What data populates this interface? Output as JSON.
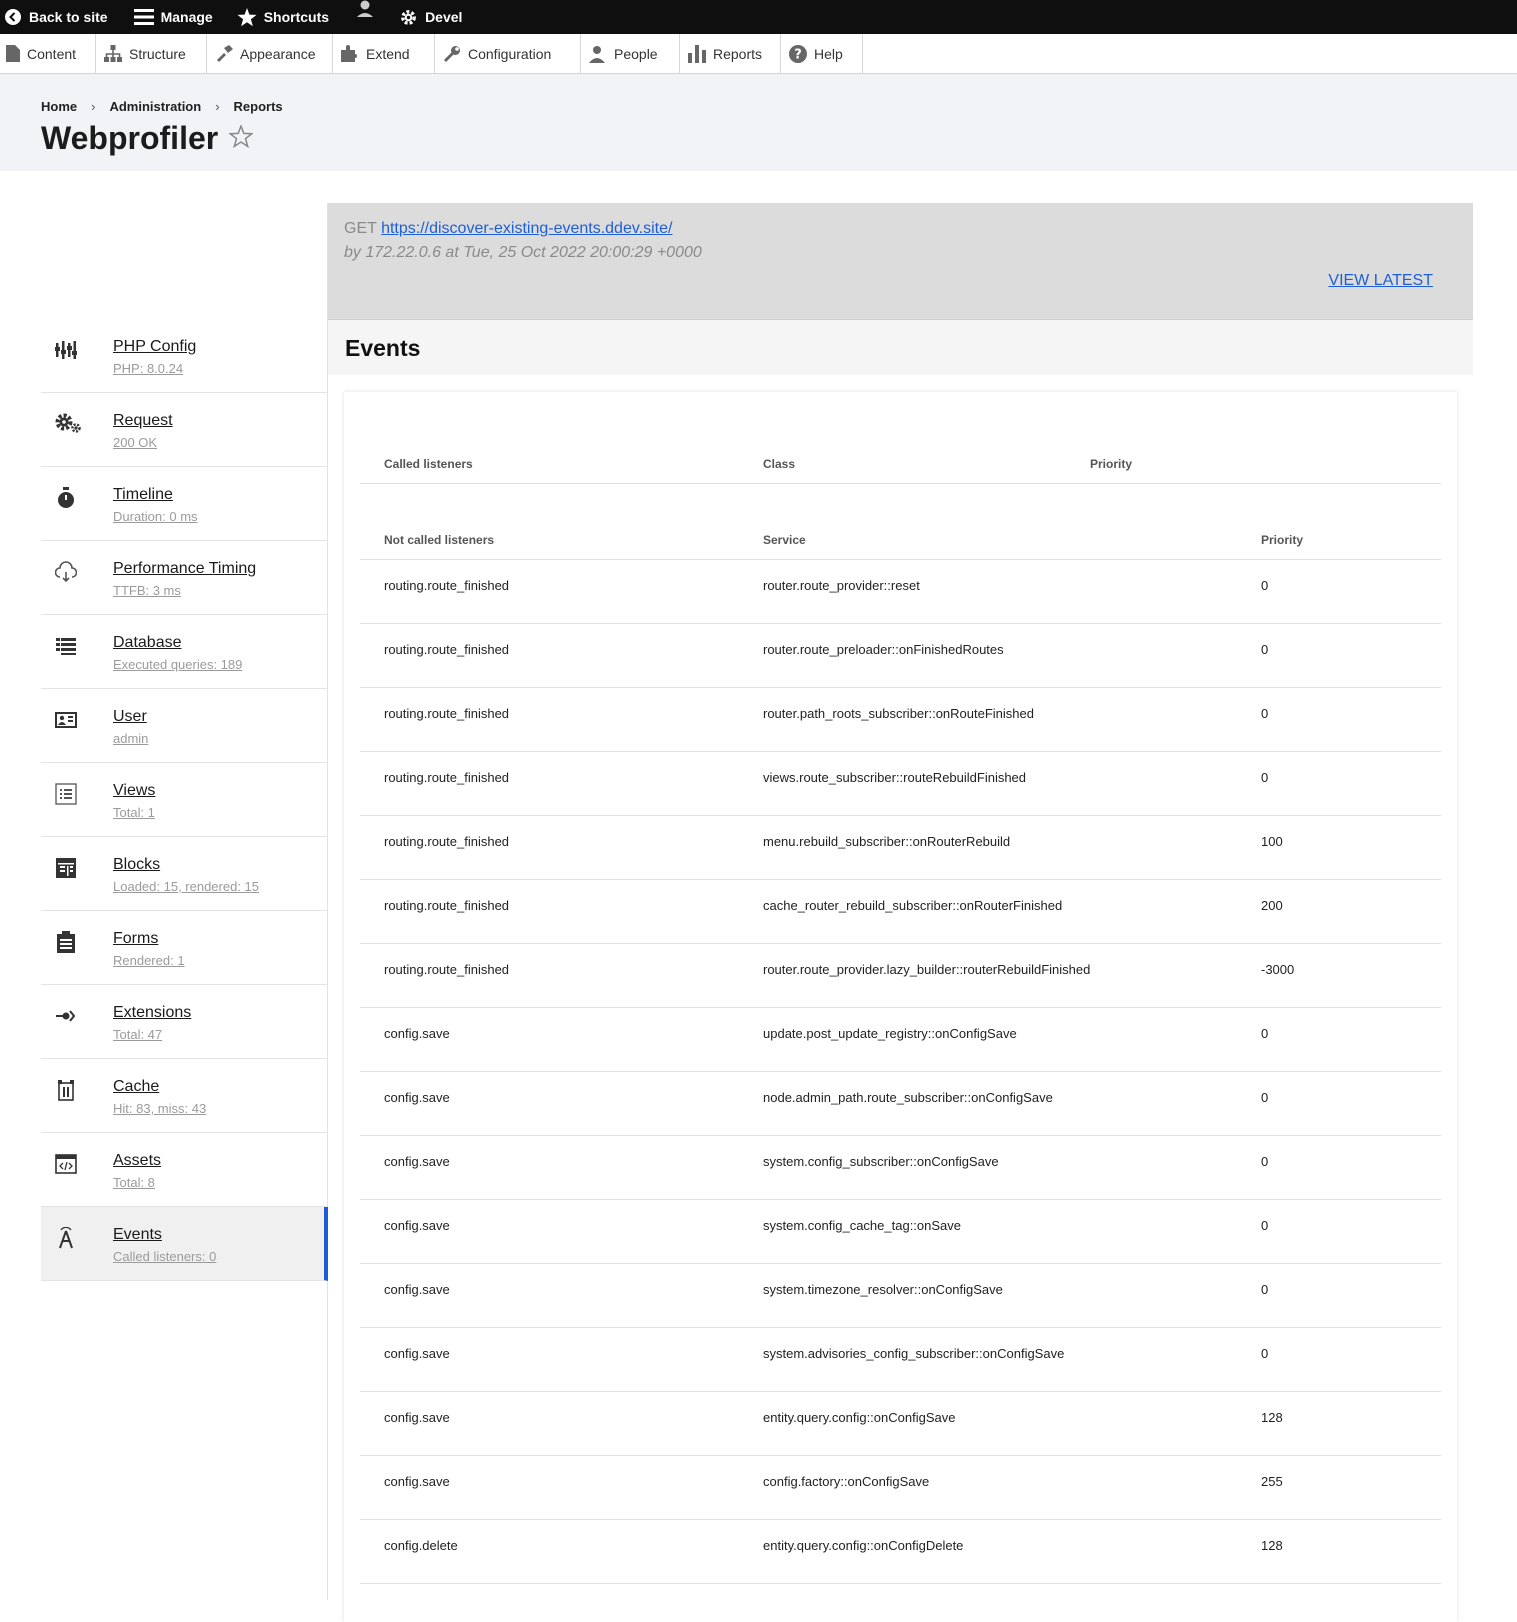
{
  "toolbar": {
    "back_to_site": "Back to site",
    "manage": "Manage",
    "shortcuts": "Shortcuts",
    "devel": "Devel"
  },
  "tray": [
    {
      "label": "Content",
      "icon": "content-icon"
    },
    {
      "label": "Structure",
      "icon": "structure-icon"
    },
    {
      "label": "Appearance",
      "icon": "appearance-icon"
    },
    {
      "label": "Extend",
      "icon": "extend-icon"
    },
    {
      "label": "Configuration",
      "icon": "configuration-icon"
    },
    {
      "label": "People",
      "icon": "people-icon"
    },
    {
      "label": "Reports",
      "icon": "reports-icon"
    },
    {
      "label": "Help",
      "icon": "help-icon"
    }
  ],
  "breadcrumb": [
    "Home",
    "Administration",
    "Reports"
  ],
  "page_title": "Webprofiler",
  "request": {
    "method": "GET",
    "url": "https://discover-existing-events.ddev.site/",
    "meta": "by 172.22.0.6 at Tue, 25 Oct 2022 20:00:29 +0000",
    "view_latest": "VIEW LATEST"
  },
  "sidebar": {
    "items": [
      {
        "title": "PHP Config",
        "sub": "PHP: 8.0.24",
        "icon": "php-config-icon"
      },
      {
        "title": "Request",
        "sub": "200 OK",
        "icon": "request-gears-icon"
      },
      {
        "title": "Timeline",
        "sub": "Duration: 0 ms",
        "icon": "timer-icon"
      },
      {
        "title": "Performance Timing",
        "sub": "TTFB: 3 ms",
        "icon": "cloud-icon"
      },
      {
        "title": "Database",
        "sub": "Executed queries: 189",
        "icon": "database-icon"
      },
      {
        "title": "User",
        "sub": "admin",
        "icon": "user-card-icon"
      },
      {
        "title": "Views",
        "sub": "Total: 1",
        "icon": "views-list-icon"
      },
      {
        "title": "Blocks",
        "sub": "Loaded: 15, rendered: 15",
        "icon": "blocks-icon"
      },
      {
        "title": "Forms",
        "sub": "Rendered: 1",
        "icon": "forms-clipboard-icon"
      },
      {
        "title": "Extensions",
        "sub": "Total: 47",
        "icon": "extensions-icon"
      },
      {
        "title": "Cache",
        "sub": "Hit: 83, miss: 43",
        "icon": "cache-icon"
      },
      {
        "title": "Assets",
        "sub": "Total: 8",
        "icon": "assets-code-icon"
      },
      {
        "title": "Events",
        "sub": "Called listeners: 0",
        "icon": "events-tower-icon"
      }
    ]
  },
  "main": {
    "title": "Events",
    "called_headers": [
      "Called listeners",
      "Class",
      "Priority"
    ],
    "not_called_headers": [
      "Not called listeners",
      "Service",
      "Priority"
    ],
    "rows": [
      [
        "routing.route_finished",
        "router.route_provider::reset",
        "0"
      ],
      [
        "routing.route_finished",
        "router.route_preloader::onFinishedRoutes",
        "0"
      ],
      [
        "routing.route_finished",
        "router.path_roots_subscriber::onRouteFinished",
        "0"
      ],
      [
        "routing.route_finished",
        "views.route_subscriber::routeRebuildFinished",
        "0"
      ],
      [
        "routing.route_finished",
        "menu.rebuild_subscriber::onRouterRebuild",
        "100"
      ],
      [
        "routing.route_finished",
        "cache_router_rebuild_subscriber::onRouterFinished",
        "200"
      ],
      [
        "routing.route_finished",
        "router.route_provider.lazy_builder::routerRebuildFinished",
        "-3000"
      ],
      [
        "config.save",
        "update.post_update_registry::onConfigSave",
        "0"
      ],
      [
        "config.save",
        "node.admin_path.route_subscriber::onConfigSave",
        "0"
      ],
      [
        "config.save",
        "system.config_subscriber::onConfigSave",
        "0"
      ],
      [
        "config.save",
        "system.config_cache_tag::onSave",
        "0"
      ],
      [
        "config.save",
        "system.timezone_resolver::onConfigSave",
        "0"
      ],
      [
        "config.save",
        "system.advisories_config_subscriber::onConfigSave",
        "0"
      ],
      [
        "config.save",
        "entity.query.config::onConfigSave",
        "128"
      ],
      [
        "config.save",
        "config.factory::onConfigSave",
        "255"
      ],
      [
        "config.delete",
        "entity.query.config::onConfigDelete",
        "128"
      ]
    ]
  },
  "colors": {
    "accent": "#1e5bd9",
    "toolbar_bg": "#0f0f0f",
    "header_bg": "#f2f3f6",
    "request_bg": "#dcdcdc"
  }
}
